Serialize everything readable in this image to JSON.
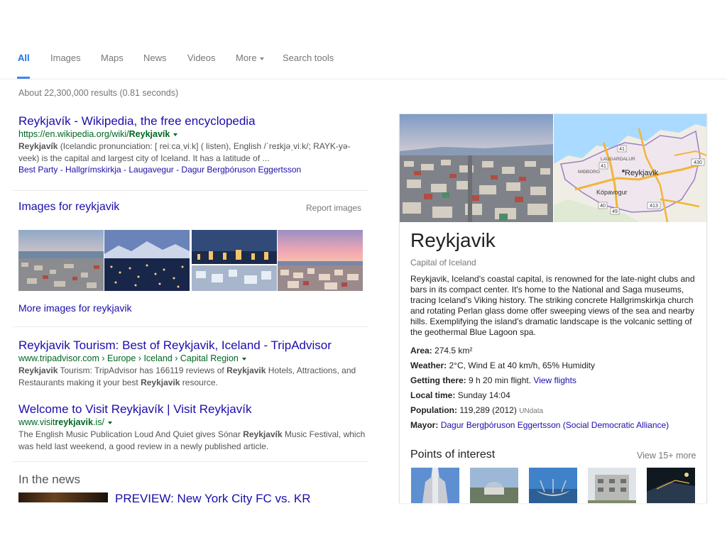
{
  "tabs": [
    {
      "label": "All",
      "active": true
    },
    {
      "label": "Images"
    },
    {
      "label": "Maps"
    },
    {
      "label": "News"
    },
    {
      "label": "Videos"
    },
    {
      "label": "More"
    },
    {
      "label": "Search tools"
    }
  ],
  "result_stats": "About 22,300,000 results (0.81 seconds)",
  "results": [
    {
      "title": "Reykjavík - Wikipedia, the free encyclopedia",
      "url_prefix": "https://en.wikipedia.org/wiki/",
      "url_bold": "Reykjavík",
      "snippet_bold_1": "Reykjavík",
      "snippet_1": " (Icelandic pronunciation: [ reiːcaˌviːk] ( listen), English /ˈreɪkjəˌviːk/; RAYK-yə-veek) is the capital and largest city of Iceland. It has a latitude of ...",
      "sitelinks": "Best Party - Hallgrímskirkja - Laugavegur - Dagur Bergþóruson Eggertsson"
    },
    {
      "title": "Reykjavik Tourism: Best of Reykjavik, Iceland - TripAdvisor",
      "url_prefix": "www.tripadvisor.com › Europe › Iceland › Capital Region",
      "snippet_bold_1": "Reykjavik",
      "snippet_1": " Tourism: TripAdvisor has 166119 reviews of ",
      "snippet_bold_2": "Reykjavik",
      "snippet_2": " Hotels, Attractions, and Restaurants making it your best ",
      "snippet_bold_3": "Reykjavik",
      "snippet_3": " resource."
    },
    {
      "title": "Welcome to Visit Reykjavík | Visit Reykjavík",
      "url_prefix": "www.visit",
      "url_bold": "reykjavik",
      "url_suffix": ".is/",
      "snippet_1": "The English Music Publication Loud And Quiet gives Sónar ",
      "snippet_bold_1": "Reykjavík",
      "snippet_2": " Music Festival, which was held last weekend, a good review in a newly published article."
    }
  ],
  "images_section": {
    "title": "Images for reykjavik",
    "report": "Report images",
    "more": "More images for reykjavik",
    "thumbnails": [
      "city-aerial-dusk",
      "city-night-mountains",
      "city-night-collage",
      "city-sunset-pink"
    ]
  },
  "news": {
    "heading": "In the news",
    "first_title": "PREVIEW: New York City FC vs. KR"
  },
  "knowledge_panel": {
    "title": "Reykjavik",
    "subtitle": "Capital of Iceland",
    "description": "Reykjavik, Iceland's coastal capital, is renowned for the late-night clubs and bars in its compact center. It's home to the National and Saga museums, tracing Iceland's Viking history. The striking concrete Hallgrimskirkja church and rotating Perlan glass dome offer sweeping views of the sea and nearby hills. Exemplifying the island's dramatic landscape is the volcanic setting of the geothermal Blue Lagoon spa.",
    "facts": {
      "area_label": "Area:",
      "area_value": "274.5 km²",
      "weather_label": "Weather:",
      "weather_value": "2°C, Wind E at 40 km/h, 65% Humidity",
      "getting_label": "Getting there:",
      "getting_value": "9 h 20 min flight.",
      "getting_link": "View flights",
      "localtime_label": "Local time:",
      "localtime_value": "Sunday 14:04",
      "population_label": "Population:",
      "population_value": "119,289 (2012)",
      "population_source": "UNdata",
      "mayor_label": "Mayor:",
      "mayor_value": "Dagur Bergþóruson Eggertsson (Social Democratic Alliance)"
    },
    "map_labels": {
      "city": "Reykjavik",
      "kopavogur": "Kópavogur",
      "laugardalur": "LAUGARDALUR",
      "midborg": "MIÐBORG",
      "road_41a": "41",
      "road_41b": "41",
      "road_40": "40",
      "road_49": "49",
      "road_413": "413",
      "road_430": "430"
    },
    "poi": {
      "heading": "Points of interest",
      "more": "View 15+ more",
      "items": [
        "hallgrimskirkja",
        "perlan",
        "sun-voyager",
        "building",
        "harpa"
      ]
    }
  },
  "colors": {
    "link": "#1a0dab",
    "url": "#006621",
    "tab_active": "#1a73e8",
    "snippet": "#545454"
  }
}
